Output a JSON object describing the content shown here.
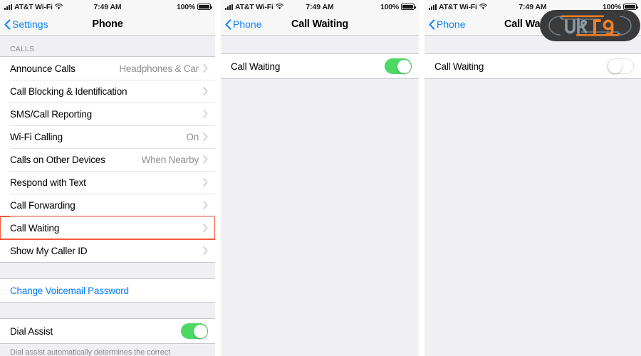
{
  "statusbar": {
    "carrier": "AT&T Wi-Fi",
    "time": "7:49 AM",
    "battery_percent": "100%",
    "signal_icon": "signal-bars-icon",
    "wifi_icon": "wifi-icon",
    "battery_icon": "battery-full-icon"
  },
  "screen1": {
    "nav": {
      "back_label": "Settings",
      "title": "Phone",
      "back_icon": "chevron-left-icon"
    },
    "group_header": "CALLS",
    "rows": [
      {
        "label": "Announce Calls",
        "value": "Headphones & Car",
        "accessory": "chevron"
      },
      {
        "label": "Call Blocking & Identification",
        "value": "",
        "accessory": "chevron"
      },
      {
        "label": "SMS/Call Reporting",
        "value": "",
        "accessory": "chevron"
      },
      {
        "label": "Wi-Fi Calling",
        "value": "On",
        "accessory": "chevron"
      },
      {
        "label": "Calls on Other Devices",
        "value": "When Nearby",
        "accessory": "chevron"
      },
      {
        "label": "Respond with Text",
        "value": "",
        "accessory": "chevron"
      },
      {
        "label": "Call Forwarding",
        "value": "",
        "accessory": "chevron"
      },
      {
        "label": "Call Waiting",
        "value": "",
        "accessory": "chevron",
        "highlighted": true
      },
      {
        "label": "Show My Caller ID",
        "value": "",
        "accessory": "chevron"
      }
    ],
    "voicemail_link": "Change Voicemail Password",
    "dial_assist": {
      "label": "Dial Assist",
      "state": "on"
    },
    "footnote": "Dial assist automatically determines the correct"
  },
  "screen2": {
    "nav": {
      "back_label": "Phone",
      "title": "Call Waiting",
      "back_icon": "chevron-left-icon"
    },
    "row": {
      "label": "Call Waiting",
      "state": "on"
    }
  },
  "screen3": {
    "nav": {
      "back_label": "Phone",
      "title": "Call Waiting",
      "back_icon": "chevron-left-icon"
    },
    "row": {
      "label": "Call Waiting",
      "state": "off"
    }
  },
  "watermark": {
    "name": "uk19-logo-watermark",
    "text_primary": "UK",
    "text_secondary": "19",
    "color_body": "#3a3a3a",
    "color_gray": "#8b99a6",
    "color_orange": "#f07f26"
  },
  "colors": {
    "accent_blue": "#007aff",
    "toggle_on_green": "#4cd964",
    "highlight_red": "#f2593c",
    "group_bg": "#efeff4"
  }
}
